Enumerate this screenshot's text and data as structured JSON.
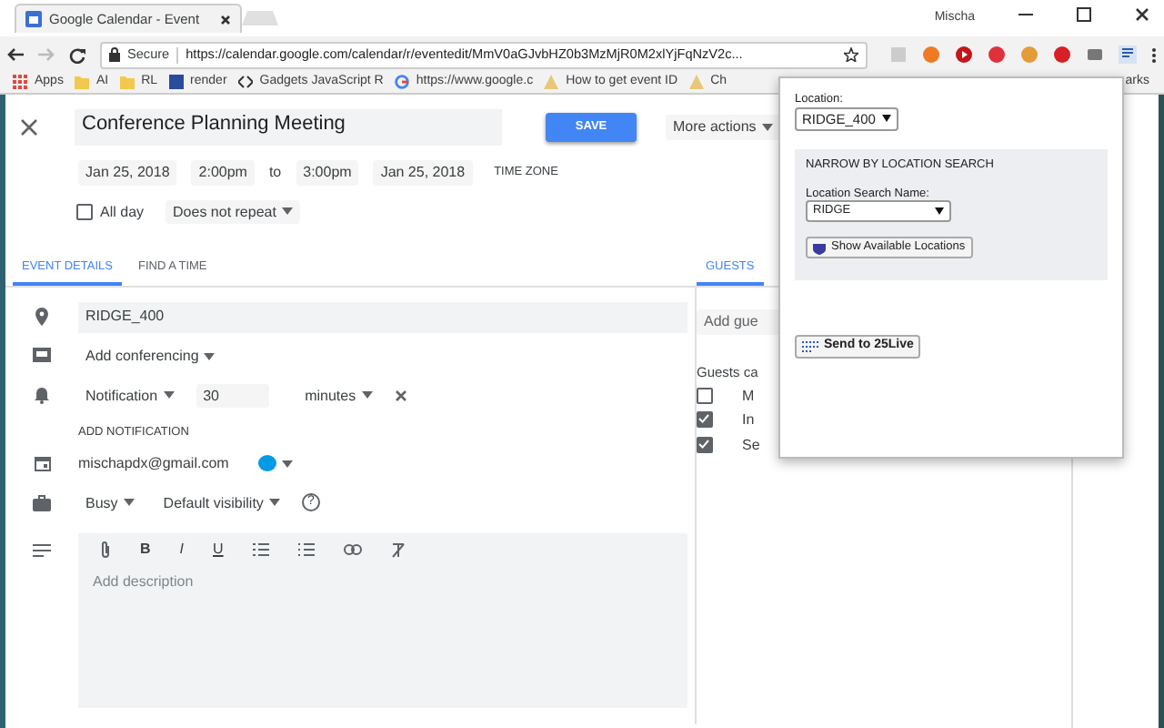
{
  "browser": {
    "tab_title": "Google Calendar - Event",
    "user": "Mischa",
    "secure": "Secure",
    "url": "https://calendar.google.com/calendar/r/eventedit/MmV0aGJvbHZ0b3MzMjR0M2xlYjFqNzV2c...",
    "bookmarks": [
      {
        "label": "Apps",
        "kind": "apps"
      },
      {
        "label": "AI",
        "kind": "folder"
      },
      {
        "label": "RL",
        "kind": "folder"
      },
      {
        "label": "render",
        "kind": "site"
      },
      {
        "label": "Gadgets JavaScript R",
        "kind": "code"
      },
      {
        "label": "https://www.google.c",
        "kind": "google"
      },
      {
        "label": "How to get event ID",
        "kind": "doc"
      },
      {
        "label": "Ch",
        "kind": "doc"
      }
    ],
    "bookmarks_end": "arks"
  },
  "event": {
    "title": "Conference Planning Meeting",
    "save": "SAVE",
    "more_actions": "More actions",
    "start_date": "Jan 25, 2018",
    "start_time": "2:00pm",
    "to": "to",
    "end_time": "3:00pm",
    "end_date": "Jan 25, 2018",
    "time_zone": "TIME ZONE",
    "all_day": {
      "label": "All day",
      "checked": false
    },
    "repeat": "Does not repeat",
    "tabs": [
      {
        "label": "EVENT DETAILS",
        "selected": true
      },
      {
        "label": "FIND A TIME",
        "selected": false
      }
    ],
    "location": "RIDGE_400",
    "conferencing": "Add conferencing",
    "notification": {
      "type": "Notification",
      "amount": "30",
      "unit": "minutes"
    },
    "add_notification": "ADD NOTIFICATION",
    "calendar": "mischapdx@gmail.com",
    "availability": "Busy",
    "visibility": "Default visibility",
    "help": "?",
    "format_buttons": [
      "B",
      "I",
      "U"
    ],
    "description_placeholder": "Add description"
  },
  "guests": {
    "tab": {
      "label": "GUESTS",
      "selected": true
    },
    "add_placeholder": "Add gue",
    "permissions_heading": "Guests ca",
    "permissions": [
      {
        "label": "M",
        "checked": false
      },
      {
        "label": "In",
        "checked": true
      },
      {
        "label": "Se",
        "checked": true
      }
    ]
  },
  "popup": {
    "location_label": "Location:",
    "location_value": "RIDGE_400",
    "section_title": "NARROW BY LOCATION SEARCH",
    "search_label": "Location Search Name:",
    "search_value": "RIDGE",
    "show_button": "Show Available Locations",
    "send_button": "Send to 25Live"
  }
}
